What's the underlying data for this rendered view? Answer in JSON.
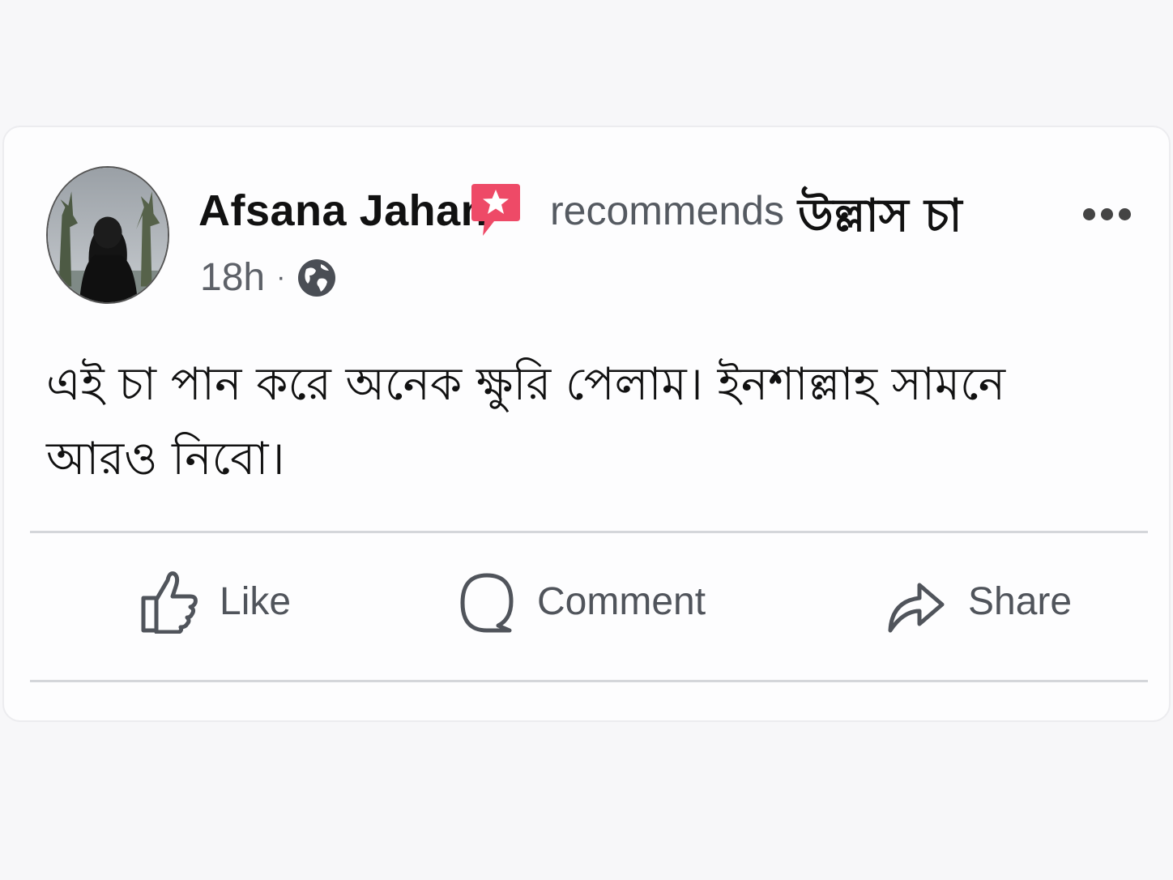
{
  "post": {
    "author": "Afsana Jahan",
    "action_text": "recommends",
    "page_name": "উল্লাস চা",
    "time": "18h",
    "separator": "·",
    "privacy_icon": "globe-icon",
    "recommend_icon": "star-speech-bubble-icon",
    "recommend_icon_color": "#ee4a67",
    "body": "এই চা পান করে অনেক ক্ষুরি পেলাম। ইনশাল্লাহ সামনে আরও নিবো।"
  },
  "actions": {
    "like_label": "Like",
    "comment_label": "Comment",
    "share_label": "Share"
  },
  "menu": {
    "more_icon": "more-options-icon"
  }
}
